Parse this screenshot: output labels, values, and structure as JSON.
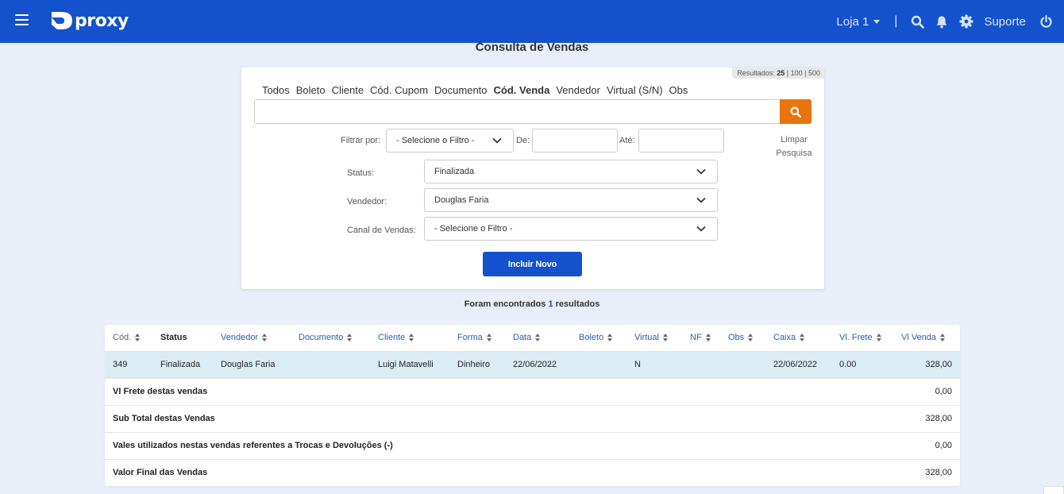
{
  "header": {
    "logo_text": "proxy",
    "store": "Loja 1",
    "separator": "|",
    "support": "Suporte",
    "icons": [
      "menu-icon",
      "search-icon",
      "bell-icon",
      "gear-icon",
      "power-icon"
    ],
    "bar_color": "#1352cc"
  },
  "page_title": "Consulta de Vendas",
  "search": {
    "results_label": "Resultados:",
    "results_options": [
      "25",
      "100",
      "500"
    ],
    "results_selected": "25",
    "tabs": [
      "Todos",
      "Boleto",
      "Cliente",
      "Cód. Cupom",
      "Documento",
      "Cód. Venda",
      "Vendedor",
      "Virtual (S/N)",
      "Obs"
    ],
    "active_tab": "Cód. Venda",
    "input_value": "",
    "search_button_color": "#e8740b"
  },
  "filters": {
    "filter_by_label": "Filtrar por:",
    "filter_by_value": "- Selecione o Filtro -",
    "from_label": "De:",
    "to_label": "Até:",
    "from_value": "",
    "to_value": "",
    "clear_link": "Limpar Pesquisa",
    "status_label": "Status:",
    "status_value": "Finalizada",
    "seller_label": "Vendedor:",
    "seller_value": "Douglas Faria",
    "channel_label": "Canal de Vendas:",
    "channel_value": "- Selecione o Filtro -"
  },
  "new_button": "Incluir Novo",
  "found": {
    "prefix": "Foram encontrados",
    "count": "1",
    "suffix": "resultados"
  },
  "table": {
    "columns": [
      "Cód.",
      "Status",
      "Vendedor",
      "Documento",
      "Cliente",
      "Forma",
      "Data",
      "Boleto",
      "Virtual",
      "NF",
      "Obs",
      "Caixa",
      "Vl. Frete",
      "Vl Venda"
    ],
    "rows": [
      [
        "349",
        "Finalizada",
        "Douglas Faria",
        "",
        "Luigi Matavelli",
        "Dinheiro",
        "22/06/2022",
        "",
        "N",
        "",
        "",
        "22/06/2022",
        "0.00",
        "328,00"
      ]
    ],
    "row_highlight_color": "#dcecf5",
    "summary": [
      {
        "label": "Vl Frete destas vendas",
        "value": "0,00"
      },
      {
        "label": "Sub Total destas Vendas",
        "value": "328,00"
      },
      {
        "label": "Vales utilizados nestas vendas referentes a Trocas e Devoluções (-)",
        "value": "0,00"
      },
      {
        "label": "Valor Final das Vendas",
        "value": "328,00"
      }
    ]
  }
}
